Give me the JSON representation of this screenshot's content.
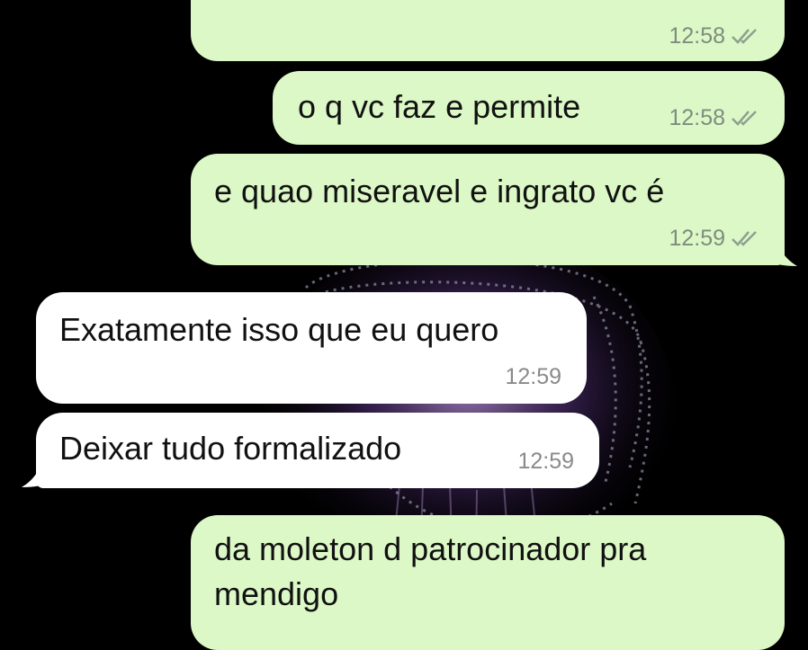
{
  "messages": [
    {
      "id": "m1",
      "direction": "outgoing",
      "text": "",
      "time": "12:58",
      "status": "read-ticks-icon"
    },
    {
      "id": "m2",
      "direction": "outgoing",
      "text": "o q vc faz e permite",
      "time": "12:58",
      "status": "read-ticks-icon"
    },
    {
      "id": "m3",
      "direction": "outgoing",
      "text": "e quao miseravel e ingrato vc é",
      "time": "12:59",
      "status": "read-ticks-icon"
    },
    {
      "id": "m4",
      "direction": "incoming",
      "text": "Exatamente isso que eu quero",
      "time": "12:59"
    },
    {
      "id": "m5",
      "direction": "incoming",
      "text": "Deixar tudo formalizado",
      "time": "12:59"
    },
    {
      "id": "m6",
      "direction": "outgoing",
      "text_line1": "da moleton d patrocinador pra",
      "text_line2": "mendigo"
    }
  ],
  "colors": {
    "outgoing_bubble": "#dcf8c6",
    "incoming_bubble": "#ffffff",
    "background": "#000000",
    "wallpaper_accent": "#7a4fb0"
  },
  "wallpaper": "jellyfish-wallpaper"
}
